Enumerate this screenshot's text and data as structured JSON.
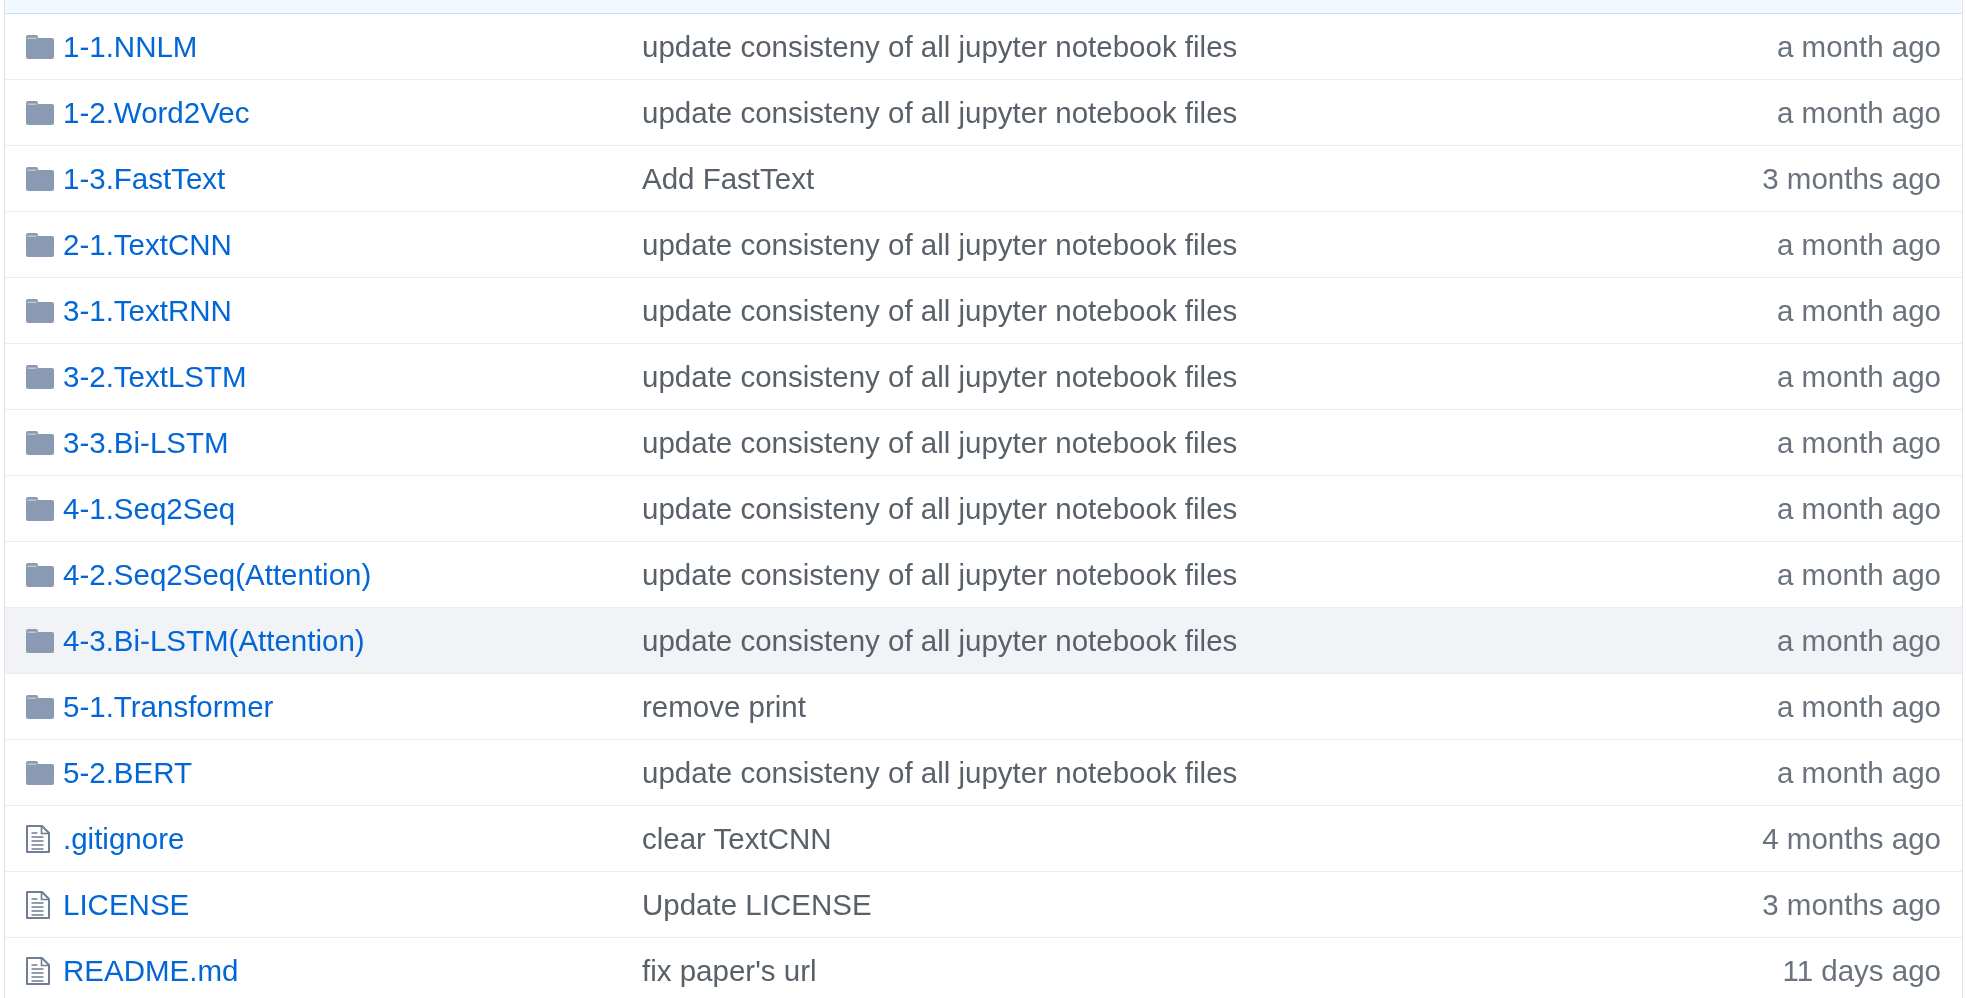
{
  "file_list": {
    "rows": [
      {
        "kind": "folder",
        "name": "1-1.NNLM",
        "message": "update consisteny of all jupyter notebook files",
        "age": "a month ago",
        "highlighted": false
      },
      {
        "kind": "folder",
        "name": "1-2.Word2Vec",
        "message": "update consisteny of all jupyter notebook files",
        "age": "a month ago",
        "highlighted": false
      },
      {
        "kind": "folder",
        "name": "1-3.FastText",
        "message": "Add FastText",
        "age": "3 months ago",
        "highlighted": false
      },
      {
        "kind": "folder",
        "name": "2-1.TextCNN",
        "message": "update consisteny of all jupyter notebook files",
        "age": "a month ago",
        "highlighted": false
      },
      {
        "kind": "folder",
        "name": "3-1.TextRNN",
        "message": "update consisteny of all jupyter notebook files",
        "age": "a month ago",
        "highlighted": false
      },
      {
        "kind": "folder",
        "name": "3-2.TextLSTM",
        "message": "update consisteny of all jupyter notebook files",
        "age": "a month ago",
        "highlighted": false
      },
      {
        "kind": "folder",
        "name": "3-3.Bi-LSTM",
        "message": "update consisteny of all jupyter notebook files",
        "age": "a month ago",
        "highlighted": false
      },
      {
        "kind": "folder",
        "name": "4-1.Seq2Seq",
        "message": "update consisteny of all jupyter notebook files",
        "age": "a month ago",
        "highlighted": false
      },
      {
        "kind": "folder",
        "name": "4-2.Seq2Seq(Attention)",
        "message": "update consisteny of all jupyter notebook files",
        "age": "a month ago",
        "highlighted": false
      },
      {
        "kind": "folder",
        "name": "4-3.Bi-LSTM(Attention)",
        "message": "update consisteny of all jupyter notebook files",
        "age": "a month ago",
        "highlighted": true
      },
      {
        "kind": "folder",
        "name": "5-1.Transformer",
        "message": "remove print",
        "age": "a month ago",
        "highlighted": false
      },
      {
        "kind": "folder",
        "name": "5-2.BERT",
        "message": "update consisteny of all jupyter notebook files",
        "age": "a month ago",
        "highlighted": false
      },
      {
        "kind": "file",
        "name": ".gitignore",
        "message": "clear TextCNN",
        "age": "4 months ago",
        "highlighted": false
      },
      {
        "kind": "file",
        "name": "LICENSE",
        "message": "Update LICENSE",
        "age": "3 months ago",
        "highlighted": false
      },
      {
        "kind": "file",
        "name": "README.md",
        "message": "fix paper's url",
        "age": "11 days ago",
        "highlighted": false
      }
    ]
  }
}
